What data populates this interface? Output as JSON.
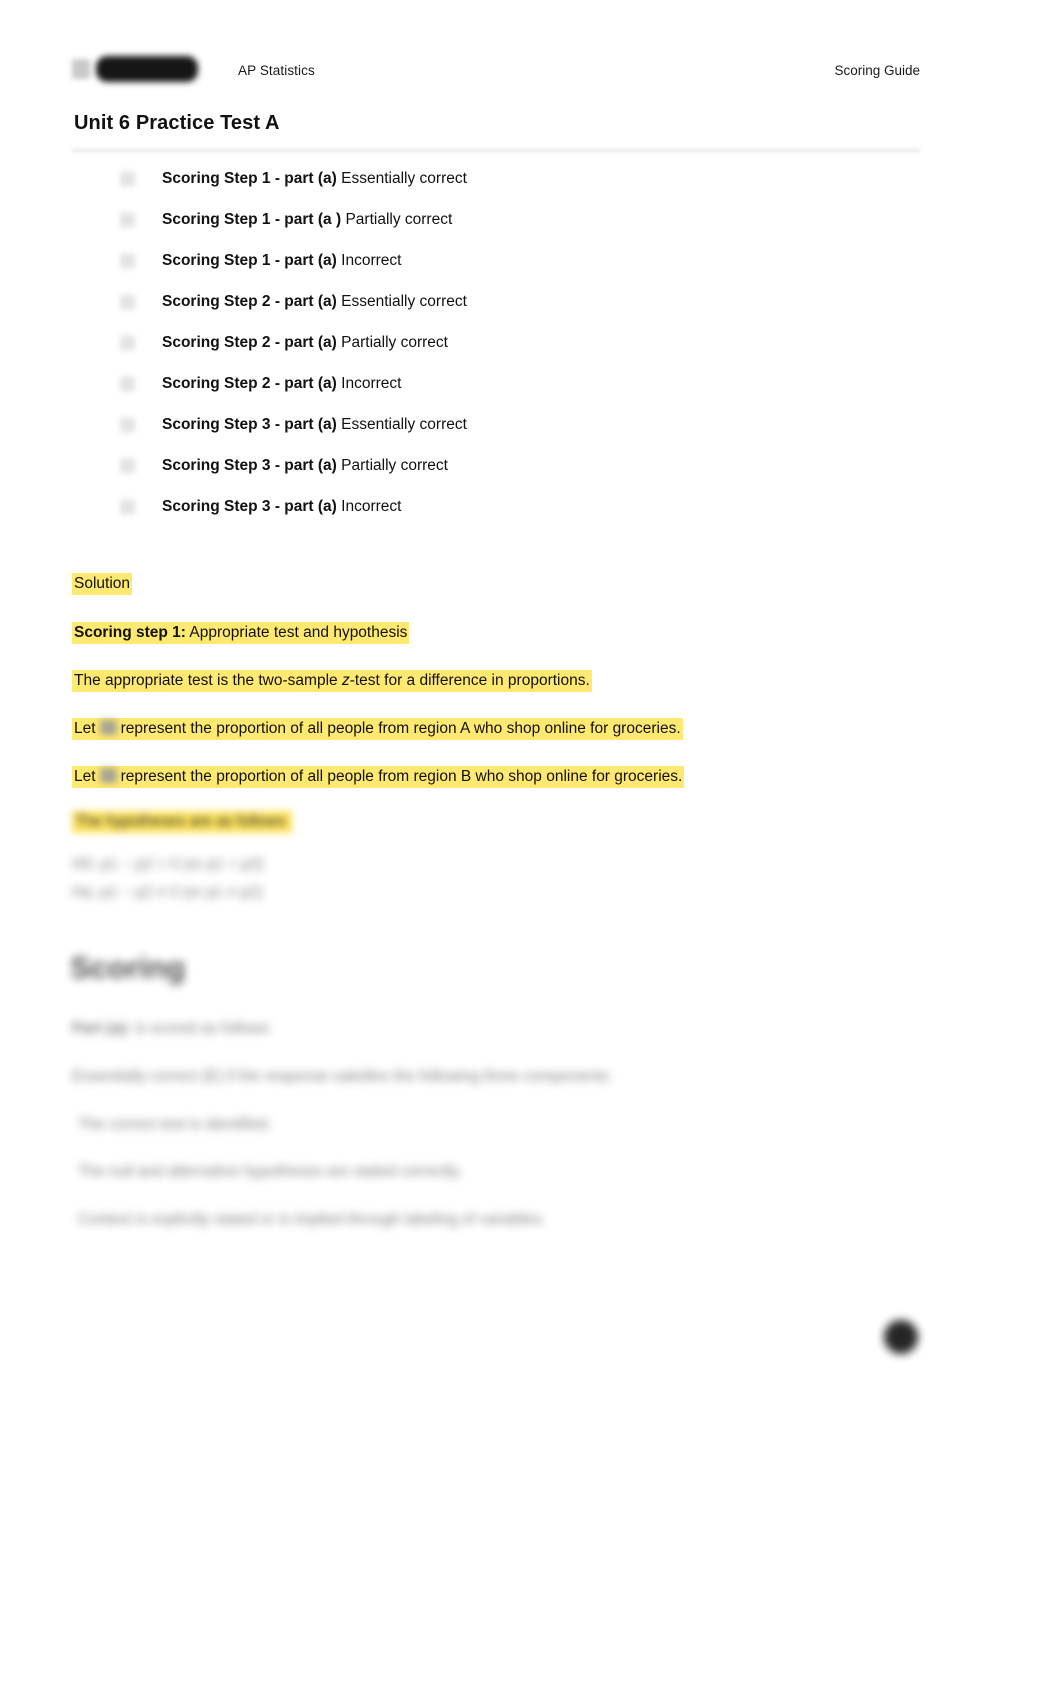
{
  "header": {
    "logo_mark_icon": "collegeboard-acorn-icon",
    "logo_wordmark_icon": "collegeboard-wordmark-redacted",
    "course": "AP Statistics",
    "right_label": "Scoring Guide"
  },
  "title": "Unit 6 Practice Test A",
  "options": [
    {
      "checkbox_icon": "checkbox-unchecked-icon",
      "strong": "Scoring Step 1 - part (a)",
      "rest": "Essentially correct"
    },
    {
      "checkbox_icon": "checkbox-unchecked-icon",
      "strong": "Scoring Step 1 - part (a )",
      "rest": "Partially correct"
    },
    {
      "checkbox_icon": "checkbox-unchecked-icon",
      "strong": "Scoring Step 1 - part (a)",
      "rest": "Incorrect"
    },
    {
      "checkbox_icon": "checkbox-unchecked-icon",
      "strong": "Scoring Step 2 - part (a)",
      "rest": "Essentially correct"
    },
    {
      "checkbox_icon": "checkbox-unchecked-icon",
      "strong": "Scoring Step 2 - part (a)",
      "rest": "Partially correct"
    },
    {
      "checkbox_icon": "checkbox-unchecked-icon",
      "strong": "Scoring Step 2 - part (a)",
      "rest": "Incorrect"
    },
    {
      "checkbox_icon": "checkbox-unchecked-icon",
      "strong": "Scoring Step 3 - part (a)",
      "rest": "Essentially correct"
    },
    {
      "checkbox_icon": "checkbox-unchecked-icon",
      "strong": "Scoring Step 3 - part (a)",
      "rest": "Partially correct"
    },
    {
      "checkbox_icon": "checkbox-unchecked-icon",
      "strong": "Scoring Step 3 - part (a)",
      "rest": "Incorrect"
    }
  ],
  "solution": {
    "heading": "Solution",
    "step1_label": "Scoring step 1:",
    "step1_text": " Appropriate test and hypothesis",
    "test_sentence_pre": "The appropriate test is the two-sample ",
    "test_sentence_var": "z",
    "test_sentence_post": "-test for a difference in proportions.",
    "let_a_pre": "Let",
    "let_a_symbol_icon": "math-symbol-p1-icon",
    "let_a_post": "represent the proportion of all people from region A who shop online for groceries.",
    "let_b_pre": "Let",
    "let_b_symbol_icon": "math-symbol-p2-icon",
    "let_b_post": "represent the proportion of all people from region B who shop online for groceries.",
    "hypotheses_intro": "The hypotheses are as follows:",
    "hypothesis_null": "H0: p1 − p2 = 0 (or p1 = p2)",
    "hypothesis_alt": "Ha: p1 − p2 ≠ 0 (or p1 ≠ p2)"
  },
  "scoring": {
    "heading": "Scoring",
    "part_label": "Part (a):",
    "part_text": " is scored as follows",
    "criteria_intro": "Essentially correct (E) if the response satisfies the following three components:",
    "bullets": [
      "The correct test is identified.",
      "The null and alternative hypotheses are stated correctly.",
      "Context is explicitly stated or is implied through labeling of variables."
    ]
  },
  "colors": {
    "highlight": "#ffe970",
    "text": "#111111",
    "page_background": "#ffffff"
  },
  "corner_badge_icon": "dark-circle-badge-icon"
}
